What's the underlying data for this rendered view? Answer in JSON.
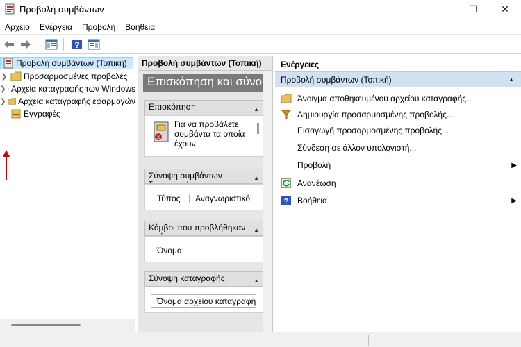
{
  "window": {
    "title": "Προβολή συμβάντων",
    "controls": {
      "minimize": "—",
      "maximize": "☐",
      "close": "✕"
    }
  },
  "menu": [
    "Αρχείο",
    "Ενέργεια",
    "Προβολή",
    "Βοήθεια"
  ],
  "toolbar": {
    "help": "?"
  },
  "tree": {
    "root": "Προβολή συμβάντων (Τοπική)",
    "items": [
      "Προσαρμοσμένες προβολές",
      "Αρχεία καταγραφής των Windows",
      "Αρχεία καταγραφής εφαρμογών",
      "Εγγραφές"
    ]
  },
  "middle": {
    "header": "Προβολή συμβάντων (Τοπική)",
    "banner": "Επισκόπηση και σύνοψη",
    "sections": [
      {
        "title": "Επισκόπηση",
        "body": "Για να προβάλετε συμβάντα τα οποία έχουν"
      },
      {
        "title": "Σύνοψη συμβάντων διαχειριστή",
        "columns": [
          "Τύπος",
          "Αναγνωριστικό"
        ]
      },
      {
        "title": "Κόμβοι που προβλήθηκαν πρόσφατα",
        "columns": [
          "Όνομα"
        ]
      },
      {
        "title": "Σύνοψη καταγραφής",
        "columns": [
          "Όνομα αρχείου καταγραφής"
        ]
      }
    ]
  },
  "actions": {
    "header": "Ενέργειες",
    "group": "Προβολή συμβάντων (Τοπική)",
    "items": [
      {
        "label": "Άνοιγμα αποθηκευμένου αρχείου καταγραφής...",
        "icon": "folder-icon"
      },
      {
        "label": "Δημιουργία προσαρμοσμένης προβολής...",
        "icon": "filter-icon"
      },
      {
        "label": "Εισαγωγή προσαρμοσμένης προβολής...",
        "icon": ""
      },
      {
        "label": "Σύνδεση σε άλλον υπολογιστή...",
        "icon": ""
      },
      {
        "label": "Προβολή",
        "icon": "",
        "submenu": "▶"
      },
      {
        "label": "Ανανέωση",
        "icon": "refresh-icon"
      },
      {
        "label": "Βοήθεια",
        "icon": "help-icon",
        "submenu": "▶"
      }
    ]
  }
}
